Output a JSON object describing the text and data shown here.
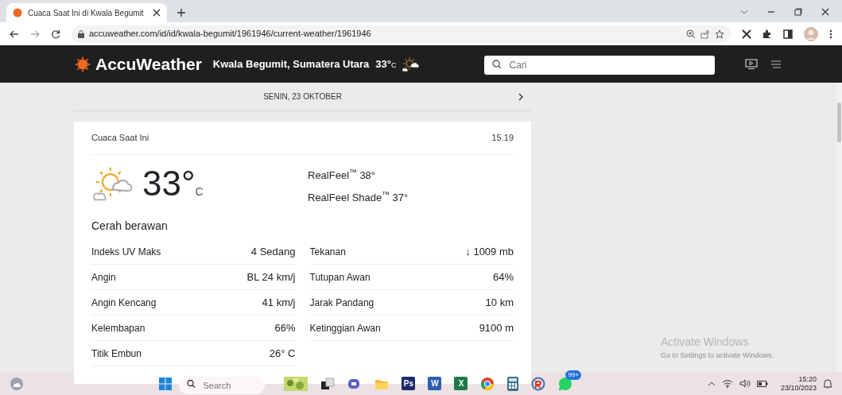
{
  "browser": {
    "tab_title": "Cuaca Saat Ini di Kwala Begumit",
    "url": "accuweather.com/id/id/kwala-begumit/1961946/current-weather/1961946"
  },
  "header": {
    "logo": "AccuWeather",
    "location": "Kwala Begumit, Sumatera Utara",
    "temp": "33°",
    "unit": "C",
    "search": {
      "placeholder": "Cari"
    }
  },
  "date_bar": {
    "label": "SENIN, 23 OKTOBER"
  },
  "current": {
    "title": "Cuaca Saat Ini",
    "time": "15.19",
    "temp": "33°",
    "unit": "C",
    "realfeel": "RealFeel$^{™}$ 38°",
    "realfeel_shade": "RealFeel Shade$^{™}$ 37°",
    "condition": "Cerah berawan",
    "details": [
      {
        "label": "Indeks UV Maks",
        "value": "4 Sedang"
      },
      {
        "label": "Tekanan",
        "value": "↓ 1009 mb"
      },
      {
        "label": "Angin",
        "value": "BL 24 km/j"
      },
      {
        "label": "Tutupan Awan",
        "value": "64%"
      },
      {
        "label": "Angin Kencang",
        "value": "41 km/j"
      },
      {
        "label": "Jarak Pandang",
        "value": "10 km"
      },
      {
        "label": "Kelembapan",
        "value": "66%"
      },
      {
        "label": "Ketinggian Awan",
        "value": "9100 m"
      },
      {
        "label": "Titik Embun",
        "value": "26° C"
      }
    ]
  },
  "activation": {
    "title": "Activate Windows",
    "subtitle": "Go to Settings to activate Windows."
  },
  "taskbar": {
    "search": {
      "placeholder": "Search"
    },
    "apps": [
      {
        "kind": "widget"
      },
      {
        "kind": "taskview"
      },
      {
        "kind": "chat"
      },
      {
        "kind": "folder"
      },
      {
        "kind": "tile",
        "label": "Ps",
        "color": "#1b2a6b"
      },
      {
        "kind": "tile",
        "label": "W",
        "color": "#2b5fb4"
      },
      {
        "kind": "tile",
        "label": "X",
        "color": "#1e7a45"
      },
      {
        "kind": "browser"
      },
      {
        "kind": "calculator"
      },
      {
        "kind": "remote"
      },
      {
        "kind": "messenger",
        "badge": "99+"
      }
    ],
    "clock": {
      "time": "15:20",
      "date": "23/10/2023"
    }
  }
}
